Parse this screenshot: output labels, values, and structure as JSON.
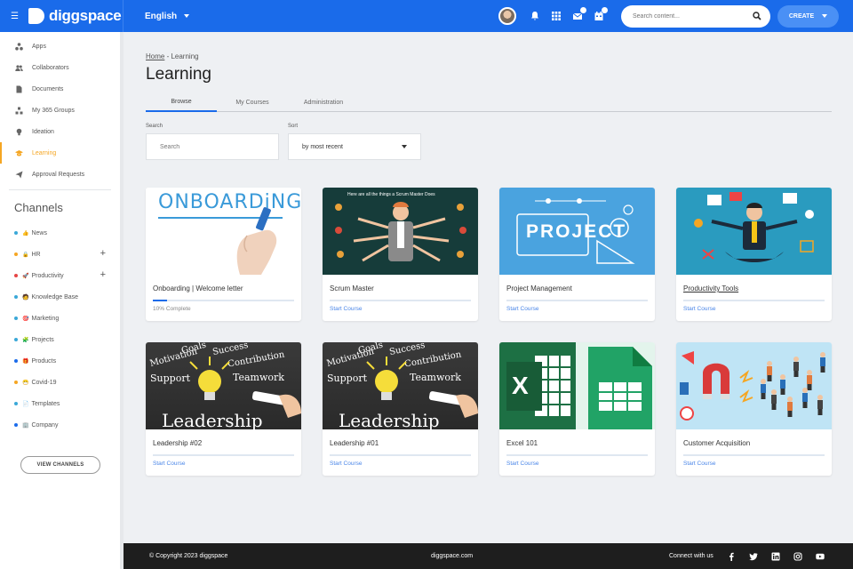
{
  "brand": {
    "name": "diggspace"
  },
  "topbar": {
    "language": "English",
    "search_placeholder": "Search content...",
    "create_label": "CREATE",
    "notif_badges": [
      "",
      ""
    ]
  },
  "sidebar": {
    "items": [
      {
        "label": "Apps",
        "icon": "apps-icon"
      },
      {
        "label": "Collaborators",
        "icon": "users-icon"
      },
      {
        "label": "Documents",
        "icon": "document-icon"
      },
      {
        "label": "My 365 Groups",
        "icon": "groups-icon"
      },
      {
        "label": "Ideation",
        "icon": "lightbulb-icon"
      },
      {
        "label": "Learning",
        "icon": "graduation-cap-icon",
        "active": true
      },
      {
        "label": "Approval Requests",
        "icon": "send-icon"
      }
    ],
    "channels_title": "Channels",
    "channels": [
      {
        "label": "News",
        "emoji": "👍",
        "dot": "#3aa8d8"
      },
      {
        "label": "HR",
        "emoji": "🔒",
        "dot": "#f5a623",
        "plus": true
      },
      {
        "label": "Productivity",
        "emoji": "🚀",
        "dot": "#e64545",
        "plus": true
      },
      {
        "label": "Knowledge Base",
        "emoji": "🧑",
        "dot": "#3aa8d8"
      },
      {
        "label": "Marketing",
        "emoji": "🎯",
        "dot": "#3aa8d8"
      },
      {
        "label": "Projects",
        "emoji": "🧩",
        "dot": "#3aa8d8"
      },
      {
        "label": "Products",
        "emoji": "🎁",
        "dot": "#1a6bea"
      },
      {
        "label": "Covid-19",
        "emoji": "😷",
        "dot": "#f5a623"
      },
      {
        "label": "Templates",
        "emoji": "📄",
        "dot": "#3aa8d8"
      },
      {
        "label": "Company",
        "emoji": "🏢",
        "dot": "#1a6bea"
      }
    ],
    "view_channels_label": "VIEW CHANNELS"
  },
  "main": {
    "breadcrumb_home": "Home",
    "breadcrumb_sep": " - ",
    "breadcrumb_current": "Learning",
    "title": "Learning",
    "tabs": [
      "Browse",
      "My Courses",
      "Administration"
    ],
    "search_label": "Search",
    "search_placeholder": "Search",
    "sort_label": "Sort",
    "sort_value": "by most recent"
  },
  "courses": [
    {
      "title": "Onboarding | Welcome letter",
      "sub": "10% Complete",
      "progress": 0.1,
      "art": "onboarding",
      "art_text": "ONBOARDiNG"
    },
    {
      "title": "Scrum Master",
      "sub": "Start Course",
      "art": "scrum",
      "art_text": "Here are all the things a Scrum Master Does"
    },
    {
      "title": "Project Management",
      "sub": "Start Course",
      "art": "project",
      "art_text": "PROJECT"
    },
    {
      "title": "Productivity Tools",
      "sub": "Start Course",
      "art": "productivity",
      "underline": true
    },
    {
      "title": "Leadership #02",
      "sub": "Start Course",
      "art": "leadership",
      "art_words": [
        "Goals",
        "Success",
        "Motivation",
        "Contribution",
        "Support",
        "Teamwork",
        "Leadership"
      ]
    },
    {
      "title": "Leadership #01",
      "sub": "Start Course",
      "art": "leadership",
      "art_words": [
        "Goals",
        "Success",
        "Motivation",
        "Contribution",
        "Support",
        "Teamwork",
        "Leadership"
      ]
    },
    {
      "title": "Excel 101",
      "sub": "Start Course",
      "art": "excel",
      "art_text": "X"
    },
    {
      "title": "Customer Acquisition",
      "sub": "Start Course",
      "art": "customer"
    }
  ],
  "footer": {
    "copyright": "© Copyright 2023 diggspace",
    "site": "diggspace.com",
    "connect": "Connect with us",
    "socials": [
      "facebook-icon",
      "twitter-icon",
      "linkedin-icon",
      "instagram-icon",
      "youtube-icon"
    ]
  },
  "colors": {
    "primary": "#1a6bea",
    "accent": "#f5a623",
    "footer": "#1e1e1e"
  }
}
